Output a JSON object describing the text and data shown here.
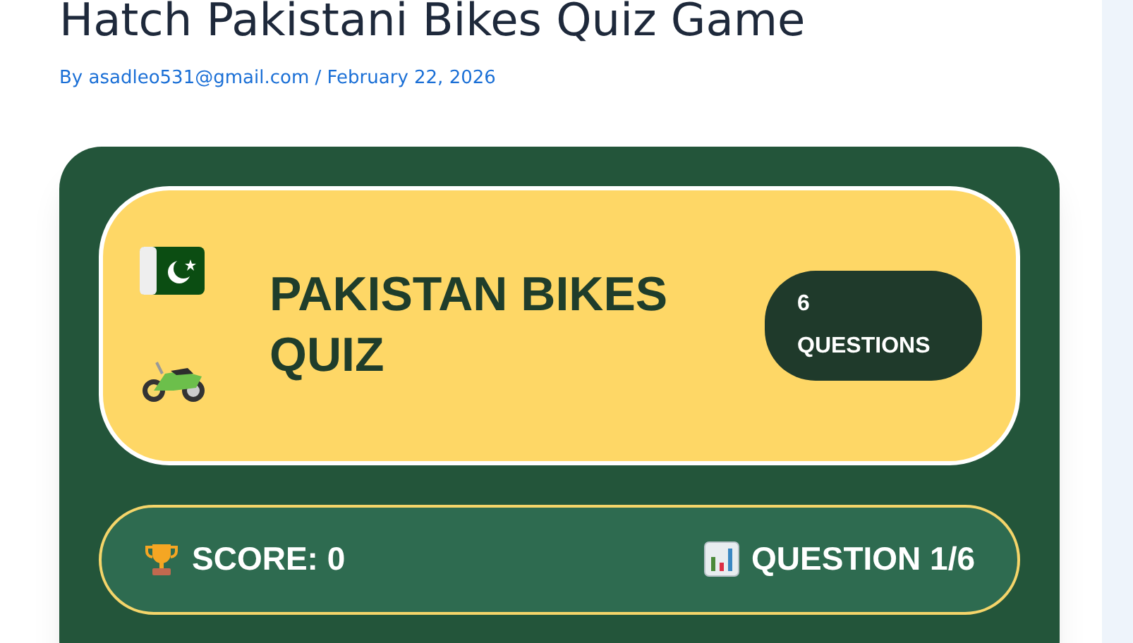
{
  "post": {
    "title": "Hatch Pakistani Bikes Quiz Game",
    "byline_prefix": "By",
    "author": "asadleo531@gmail.com",
    "separator": "/",
    "date": "February 22, 2026"
  },
  "quiz": {
    "title": "PAKISTAN BIKES QUIZ",
    "badge_count": "6",
    "badge_label": "QUESTIONS",
    "score": "SCORE: 0",
    "question_counter": "QUESTION 1/6"
  }
}
